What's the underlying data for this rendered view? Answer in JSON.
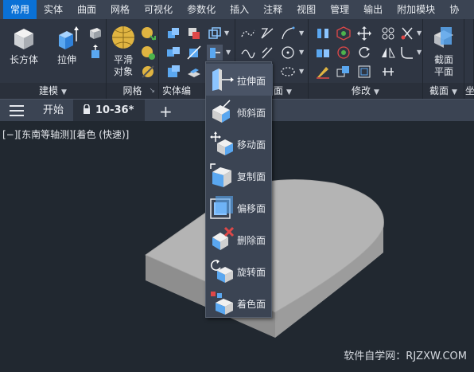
{
  "menu_tabs": [
    "常用",
    "实体",
    "曲面",
    "网格",
    "可视化",
    "参数化",
    "插入",
    "注释",
    "视图",
    "管理",
    "输出",
    "附加模块",
    "协"
  ],
  "ribbon": {
    "box_label": "长方体",
    "extrude_label": "拉伸",
    "smooth_label_1": "平滑",
    "smooth_label_2": "对象",
    "section_label_1": "截面",
    "section_label_2": "平面",
    "panels": {
      "modeling": "建模",
      "mesh": "网格",
      "solid_edit": "实体编",
      "solid_edit_tail": "面",
      "modify": "修改",
      "section": "截面",
      "extra": "坐"
    }
  },
  "file_tabs": {
    "start": "开始",
    "active": "10-36*"
  },
  "viewport": {
    "label": "[−][东南等轴测][着色 (快速)]",
    "watermark": "软件自学网：RJZXW.COM"
  },
  "dropdown": {
    "items": [
      {
        "label": "拉伸面",
        "icon": "extrude-face-icon"
      },
      {
        "label": "倾斜面",
        "icon": "taper-face-icon"
      },
      {
        "label": "移动面",
        "icon": "move-face-icon"
      },
      {
        "label": "复制面",
        "icon": "copy-face-icon"
      },
      {
        "label": "偏移面",
        "icon": "offset-face-icon"
      },
      {
        "label": "删除面",
        "icon": "delete-face-icon"
      },
      {
        "label": "旋转面",
        "icon": "rotate-face-icon"
      },
      {
        "label": "着色面",
        "icon": "color-face-icon"
      }
    ]
  },
  "colors": {
    "accent": "#0a71d6",
    "menubar": "#3b4453",
    "ribbon": "#2f3643",
    "viewport": "#212830",
    "model": "#b4b4b4"
  }
}
